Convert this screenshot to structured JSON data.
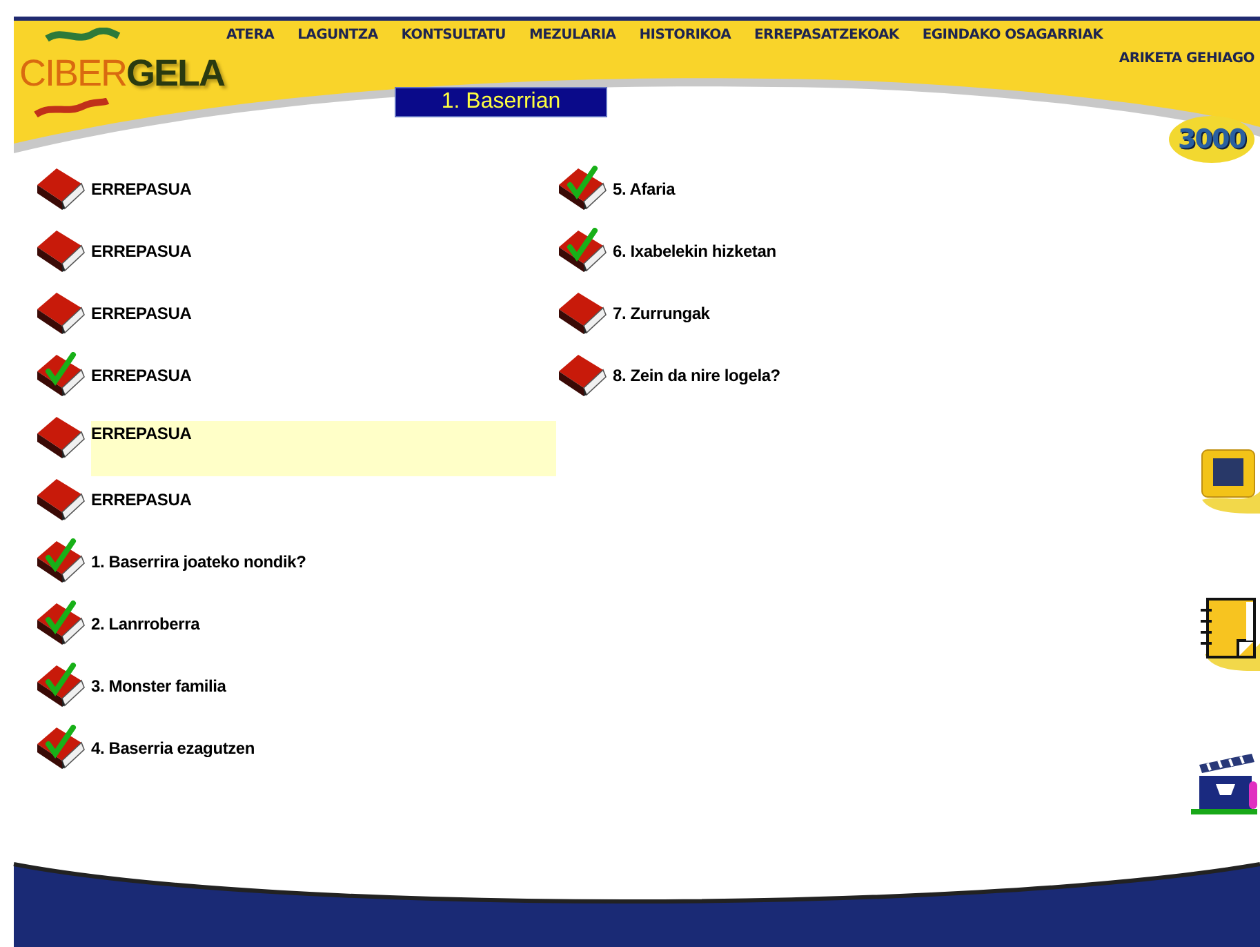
{
  "logo": {
    "text": "CIBER**GELA**"
  },
  "nav": [
    {
      "label": "ATERA"
    },
    {
      "label": "LAGUNTZA"
    },
    {
      "label": "KONTSULTATU"
    },
    {
      "label": "MEZULARIA"
    },
    {
      "label": "HISTORIKOA"
    },
    {
      "label": "ERREPASATZEKOAK"
    },
    {
      "label": "EGINDAKO OSAGARRIAK"
    }
  ],
  "nav_second": {
    "label": "ARIKETA GEHIAGO"
  },
  "title": "1. Baserrian",
  "badge": "3000",
  "columns": [
    {
      "items": [
        {
          "label": "ERREPASUA",
          "done": false,
          "selected": false
        },
        {
          "label": "ERREPASUA",
          "done": false,
          "selected": false
        },
        {
          "label": "ERREPASUA",
          "done": false,
          "selected": false
        },
        {
          "label": "ERREPASUA",
          "done": true,
          "selected": false
        },
        {
          "label": "ERREPASUA",
          "done": false,
          "selected": true
        },
        {
          "label": "ERREPASUA",
          "done": false,
          "selected": false
        },
        {
          "label": "1. Baserrira joateko nondik?",
          "done": true,
          "selected": false
        },
        {
          "label": "2. Lanrroberra",
          "done": true,
          "selected": false
        },
        {
          "label": "3. Monster familia",
          "done": true,
          "selected": false
        },
        {
          "label": "4. Baserria ezagutzen",
          "done": true,
          "selected": false
        }
      ]
    },
    {
      "items": [
        {
          "label": "5. Afaria",
          "done": true,
          "selected": false
        },
        {
          "label": "6. Ixabelekin hizketan",
          "done": true,
          "selected": false
        },
        {
          "label": "7. Zurrungak",
          "done": false,
          "selected": false
        },
        {
          "label": "8. Zein da nire logela?",
          "done": false,
          "selected": false
        }
      ]
    }
  ],
  "side_tools": [
    {
      "kind": "monitor"
    },
    {
      "kind": "notebook"
    },
    {
      "kind": "clapper"
    }
  ]
}
